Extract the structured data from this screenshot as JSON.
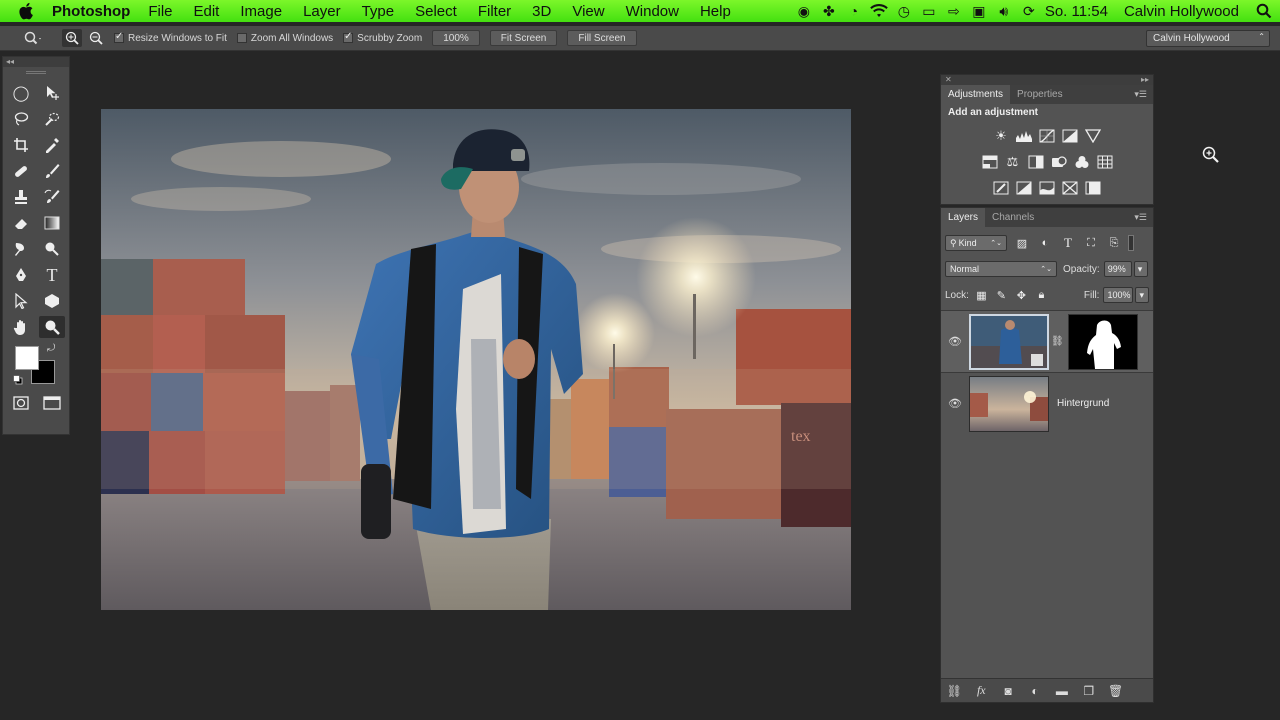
{
  "menubar": {
    "app_name": "Photoshop",
    "items": [
      "File",
      "Edit",
      "Image",
      "Layer",
      "Type",
      "Select",
      "Filter",
      "3D",
      "View",
      "Window",
      "Help"
    ],
    "clock": "So. 11:54",
    "user": "Calvin Hollywood",
    "status_icons": [
      "adobe-icon",
      "game-controller-icon",
      "timer-icon",
      "wifi-icon",
      "time-machine-icon",
      "display-icon",
      "arrow-icon",
      "screen-icon",
      "volume-icon",
      "sync-icon"
    ]
  },
  "optionsbar": {
    "resize_windows": "Resize Windows to Fit",
    "zoom_all": "Zoom All Windows",
    "scrubby_zoom": "Scrubby Zoom",
    "zoom_value": "100%",
    "fit_screen": "Fit Screen",
    "fill_screen": "Fill Screen",
    "workspace": "Calvin Hollywood"
  },
  "adjustments": {
    "tabs": [
      "Adjustments",
      "Properties"
    ],
    "title": "Add an adjustment"
  },
  "layers": {
    "tabs": [
      "Layers",
      "Channels"
    ],
    "kind": "Kind",
    "blend_mode": "Normal",
    "opacity_label": "Opacity:",
    "opacity_value": "99%",
    "lock_label": "Lock:",
    "fill_label": "Fill:",
    "fill_value": "100%",
    "items": [
      {
        "name": "",
        "has_mask": true
      },
      {
        "name": "Hintergrund",
        "has_mask": false
      }
    ]
  }
}
